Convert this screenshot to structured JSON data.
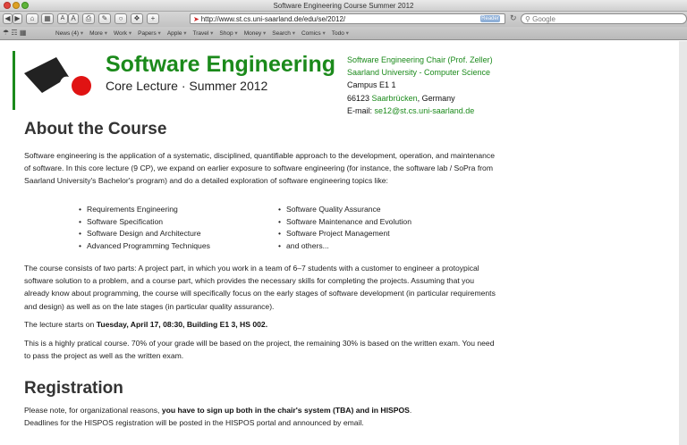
{
  "window": {
    "title": "Software Engineering Course Summer 2012"
  },
  "toolbar": {
    "font_smaller": "A",
    "font_larger": "A",
    "add_label": "+",
    "url": "http://www.st.cs.uni-saarland.de/edu/se/2012/",
    "reader_label": "Reader",
    "search_placeholder": "Google"
  },
  "bookmarks": [
    {
      "label": "News (4)",
      "dropdown": true
    },
    {
      "label": "More",
      "dropdown": true
    },
    {
      "label": "Work",
      "dropdown": true
    },
    {
      "label": "Papers",
      "dropdown": true
    },
    {
      "label": "Apple",
      "dropdown": true
    },
    {
      "label": "Travel",
      "dropdown": true
    },
    {
      "label": "Shop",
      "dropdown": true
    },
    {
      "label": "Money",
      "dropdown": true
    },
    {
      "label": "Search",
      "dropdown": true
    },
    {
      "label": "Comics",
      "dropdown": true
    },
    {
      "label": "Todo",
      "dropdown": true
    }
  ],
  "header": {
    "title": "Software Engineering",
    "subtitle": "Core Lecture · Summer 2012",
    "contact": {
      "chair": "Software Engineering Chair (Prof. Zeller)",
      "university": "Saarland University - Computer Science",
      "campus": "Campus E1 1",
      "postcode": "66123",
      "city": "Saarbrücken",
      "country": ", Germany",
      "email_label": "E-mail:",
      "email": "se12@st.cs.uni-saarland.de"
    }
  },
  "about": {
    "heading": "About the Course",
    "intro": "Software engineering is the application of a systematic, disciplined, quantifiable approach to the development, operation, and maintenance of software. In this core lecture (9 CP), we expand on earlier exposure to software engineering (for instance, the software lab / SoPra from Saarland University's Bachelor's program) and do a detailed exploration of software engineering topics like:",
    "topics_left": [
      "Requirements Engineering",
      "Software Specification",
      "Software Design and Architecture",
      "Advanced Programming Techniques"
    ],
    "topics_right": [
      "Software Quality Assurance",
      "Software Maintenance and Evolution",
      "Software Project Management",
      "and others..."
    ],
    "parts": "The course consists of two parts: A project part, in which you work in a team of 6–7 students with a customer to engineer a protoypical software solution to a problem, and a course part, which provides the necessary skills for completing the projects. Assuming that you already know about programming, the course will specifically focus on the early stages of software development (in particular requirements and design) as well as on the late stages (in particular quality assurance).",
    "start_prefix": "The lecture starts on ",
    "start_bold": "Tuesday, April 17, 08:30, Building E1 3, HS 002.",
    "grading": "This is a highly pratical course. 70% of your grade will be based on the project, the remaining 30% is based on the written exam. You need to pass the project as well as the written exam."
  },
  "registration": {
    "heading": "Registration",
    "note_prefix": "Please note, for organizational reasons, ",
    "note_bold": "you have to sign up both in the chair's system (TBA) and in HISPOS",
    "note_suffix": ".",
    "deadline": "Deadlines for the HISPOS registration will be posted in the HISPOS portal and announced by email."
  }
}
